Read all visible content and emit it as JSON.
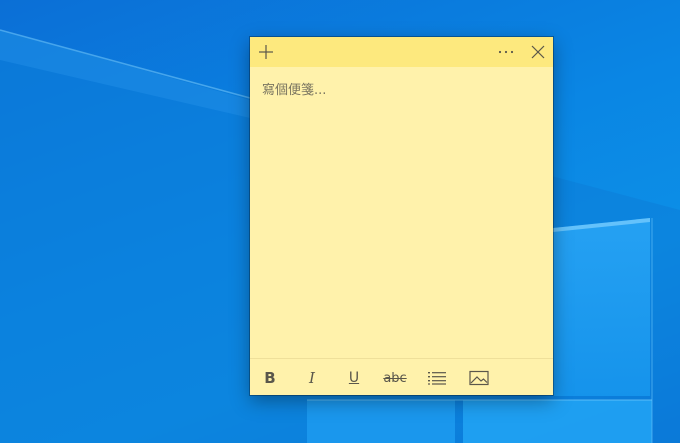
{
  "note": {
    "placeholder": "寫個便箋...",
    "header": {
      "add_icon": "plus-icon",
      "menu_icon": "more-horizontal-icon",
      "close_icon": "close-icon"
    },
    "toolbar": {
      "bold_label": "B",
      "italic_label": "I",
      "underline_label": "U",
      "strikethrough_label": "abc",
      "list_icon": "bulleted-list-icon",
      "image_icon": "image-icon"
    }
  },
  "colors": {
    "note_body": "#fff2ab",
    "note_header": "#fde97e",
    "desktop_blue": "#0a86e4"
  }
}
